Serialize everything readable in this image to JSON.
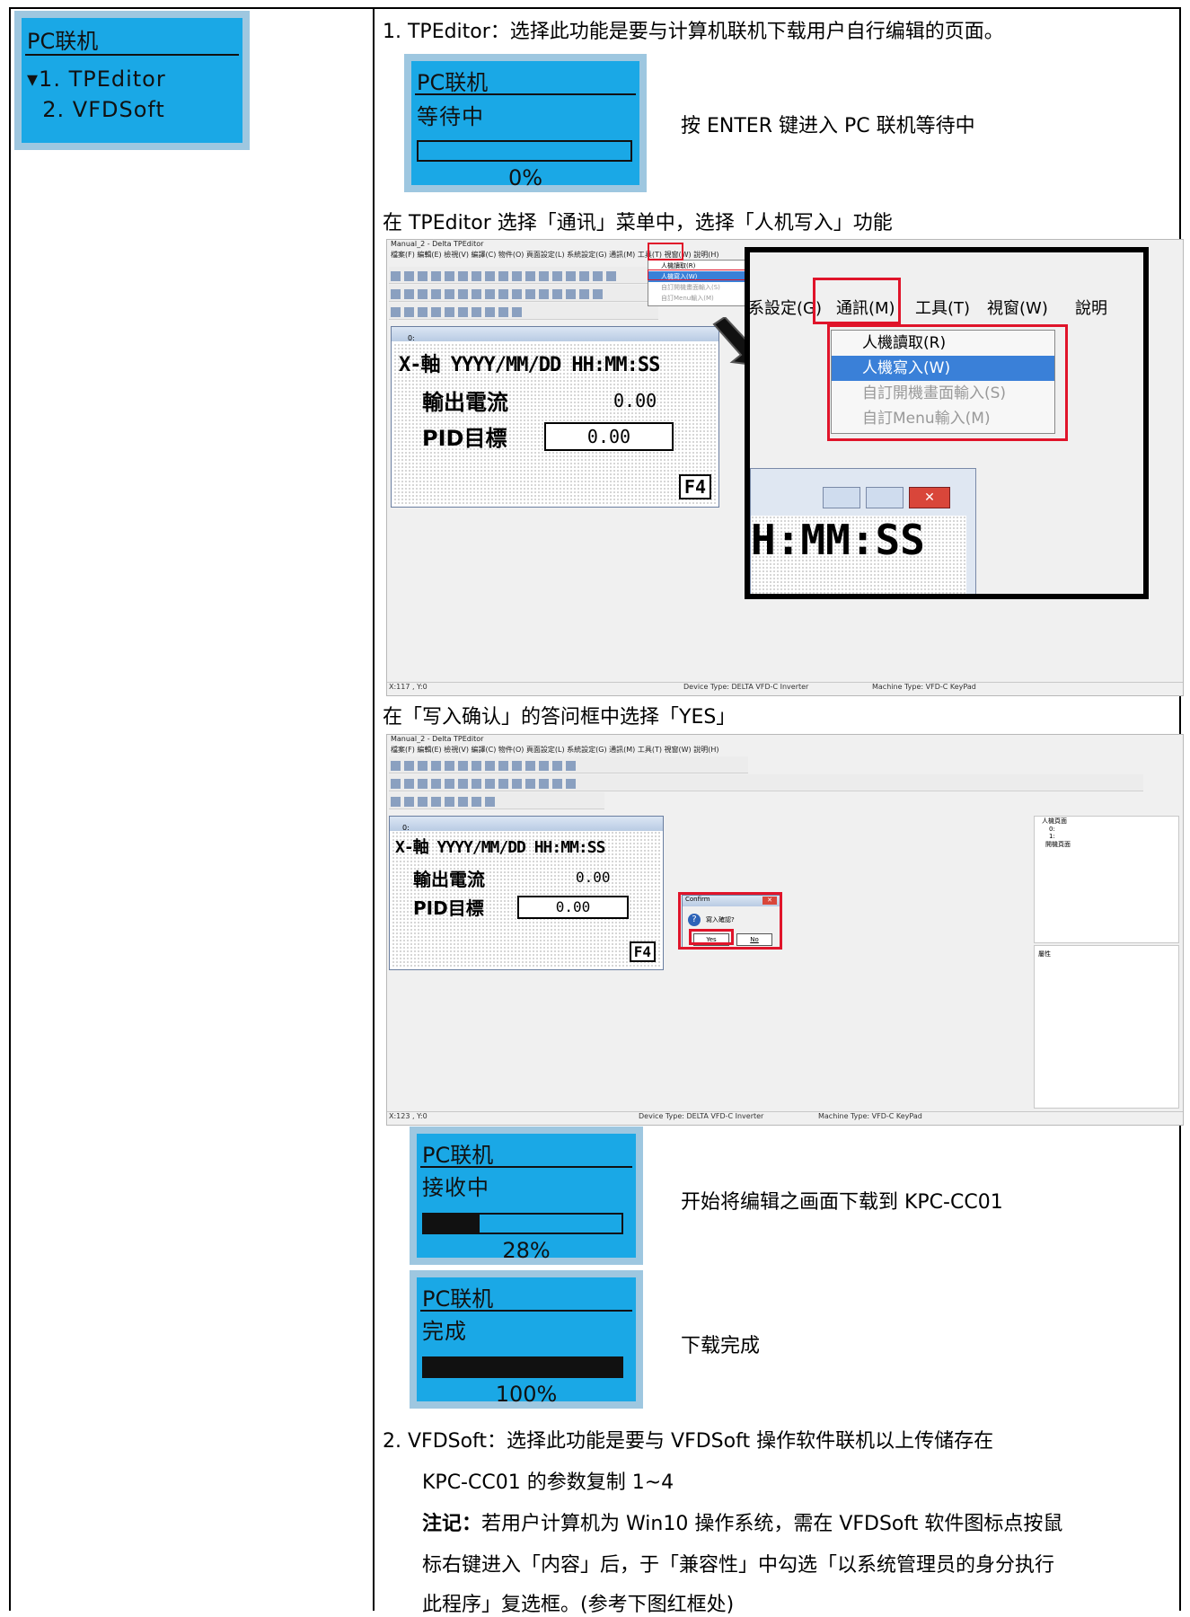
{
  "left_menu": {
    "title": "PC联机",
    "items": [
      "▾1. TPEditor",
      "  2. VFDSoft"
    ]
  },
  "sections": {
    "s1": "1.  TPEditor：选择此功能是要与计算机联机下载用户自行编辑的页面。",
    "lcd_wait": {
      "title": "PC联机",
      "status": "等待中",
      "pct": "0%",
      "progress": 0
    },
    "note_enter": "按 ENTER  键进入 PC 联机等待中",
    "instr_menu": "在 TPEditor 选择「通讯」菜单中，选择「人机写入」功能",
    "instr_confirm": "在「写入确认」的答问框中选择「YES」",
    "lcd_recv": {
      "title": "PC联机",
      "status": "接收中",
      "pct": "28%",
      "progress": 28
    },
    "note_download": "开始将编辑之画面下载到 KPC-CC01",
    "lcd_done": {
      "title": "PC联机",
      "status": "完成",
      "pct": "100%",
      "progress": 100
    },
    "note_done": "下载完成",
    "s2_line1": "2.  VFDSoft：选择此功能是要与 VFDSoft 操作软件联机以上传储存在",
    "s2_line2": "KPC-CC01 的参数复制 1~4",
    "note_label": "注记：",
    "note_line1": "若用户计算机为 Win10 操作系统，需在 VFDSoft 软件图标点按鼠",
    "note_line2": "标右键进入「内容」后，于「兼容性」中勾选「以系统管理员的身分执行",
    "note_line3": "此程序」复选框。(参考下图红框处)"
  },
  "screenshot1": {
    "window_title": "Manual_2 - Delta TPEditor",
    "menu": "檔案(F)  編輯(E)  檢視(V)  編譯(C)  物件(O)  頁面設定(L)  系統設定(G)  通訊(M)  工具(T)  視窗(W)  說明(H)",
    "sub_title": "0:",
    "lcd_line1": "X-軸  YYYY/MM/DD HH:MM:SS",
    "lcd_label1": "輸出電流",
    "lcd_val1": "0.00",
    "lcd_label2": "PID目標",
    "lcd_val2": "0.00",
    "lcd_key": "F4",
    "zoom_menu": [
      "系設定(G)",
      "通訊(M)",
      "工具(T)",
      "視窗(W)",
      "說明"
    ],
    "zoom_items": [
      "人機讀取(R)",
      "人機寫入(W)",
      "自訂開機畫面輸入(S)",
      "自訂Menu輸入(M)"
    ],
    "zoom_clock": "H:MM:SS",
    "status_left": "X:117 , Y:0",
    "status_mid": "Device Type: DELTA VFD-C Inverter",
    "status_right": "Machine Type: VFD-C KeyPad"
  },
  "screenshot2": {
    "window_title": "Manual_2 - Delta TPEditor",
    "menu": "檔案(F)  編輯(E)  檢視(V)  編譯(C)  物件(O)  頁面設定(L)  系統設定(G)  通訊(M)  工具(T)  視窗(W)  說明(H)",
    "sub_title": "0:",
    "lcd_line1": "X-軸  YYYY/MM/DD HH:MM:SS",
    "lcd_label1": "輸出電流",
    "lcd_val1": "0.00",
    "lcd_label2": "PID目標",
    "lcd_val2": "0.00",
    "lcd_key": "F4",
    "dialog_title": "Confirm",
    "dialog_msg": "寫入確認?",
    "dialog_yes": "Yes",
    "dialog_no": "No",
    "tree_root": "人機頁面",
    "tree_items": [
      "0:",
      "1:",
      "開機頁面"
    ],
    "prop_label": "屬性",
    "status_left": "X:123 , Y:0",
    "status_mid": "Device Type: DELTA VFD-C Inverter",
    "status_right": "Machine Type: VFD-C KeyPad"
  },
  "colors": {
    "lcd": "#1aa8e6",
    "lcd_border": "#9ec7e0",
    "highlight": "#e0142a",
    "select": "#3a80d8"
  }
}
